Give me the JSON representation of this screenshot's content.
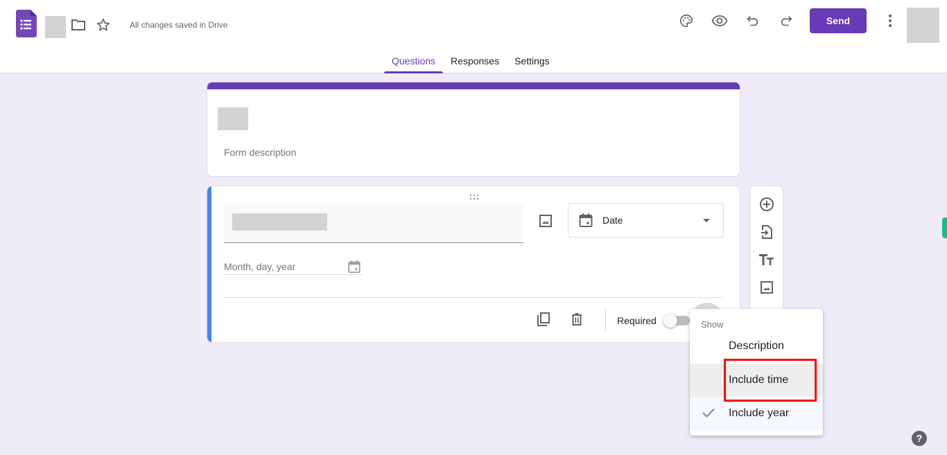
{
  "header": {
    "app_icon": "google-forms-icon",
    "save_status": "All changes saved in Drive",
    "icons": [
      "folder-icon",
      "star-icon",
      "palette-icon",
      "eye-icon",
      "undo-icon",
      "redo-icon",
      "more-vert-icon"
    ],
    "send_label": "Send",
    "brand_color": "#673ab7"
  },
  "tabs": [
    {
      "label": "Questions",
      "active": true
    },
    {
      "label": "Responses",
      "active": false
    },
    {
      "label": "Settings",
      "active": false
    }
  ],
  "title_card": {
    "description_placeholder": "Form description"
  },
  "question_card": {
    "type_select": {
      "icon": "calendar-icon",
      "selected": "Date"
    },
    "date_input_placeholder": "Month, day, year",
    "footer": {
      "required_label": "Required",
      "required_on": false
    },
    "accent_color": "#4285f4"
  },
  "side_toolbar": {
    "items": [
      "add-question-icon",
      "import-questions-icon",
      "add-title-icon",
      "add-image-icon"
    ]
  },
  "menu": {
    "header": "Show",
    "items": [
      {
        "label": "Description",
        "checked": false
      },
      {
        "label": "Include time",
        "checked": false,
        "highlighted": true
      },
      {
        "label": "Include year",
        "checked": true
      }
    ]
  },
  "help": {
    "label": "?"
  }
}
